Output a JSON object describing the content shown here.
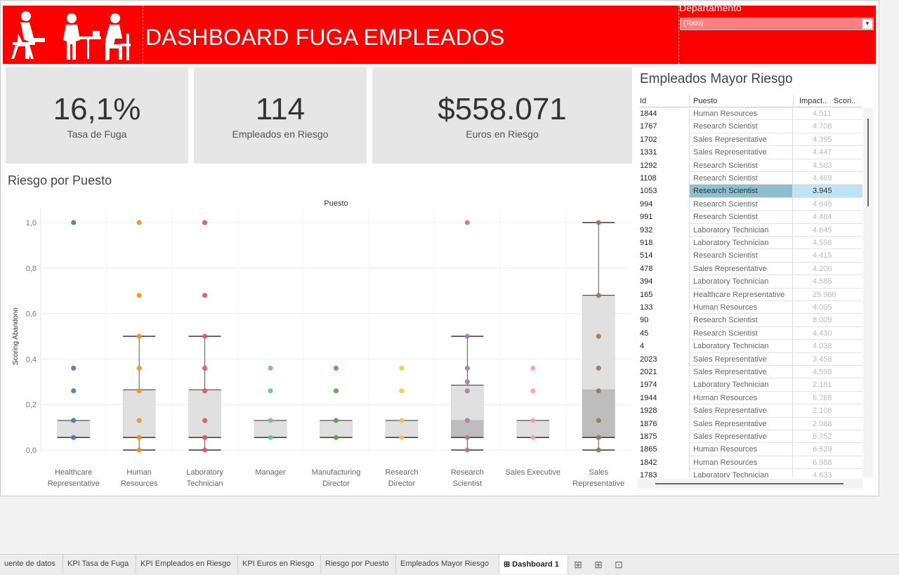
{
  "header": {
    "title": "DASHBOARD FUGA EMPLEADOS",
    "filter_label": "Departamento",
    "filter_value": "(Todo)"
  },
  "kpis": [
    {
      "value": "16,1%",
      "label": "Tasa de Fuga"
    },
    {
      "value": "114",
      "label": "Empleados en Riesgo"
    },
    {
      "value": "$558.071",
      "label": "Euros en Riesgo"
    }
  ],
  "chart_title": "Riesgo por Puesto",
  "chart_data": {
    "type": "scatter",
    "title": "Puesto",
    "xlabel": "",
    "ylabel": "Scoring Abandono",
    "ylim": [
      0,
      1.0
    ],
    "yticks": [
      "0,0",
      "0,2",
      "0,4",
      "0,6",
      "0,8",
      "1,0"
    ],
    "grid": true,
    "categories": [
      "Healthcare Representative",
      "Human Resources",
      "Laboratory Technician",
      "Manager",
      "Manufacturing Director",
      "Research Director",
      "Research Scientist",
      "Sales Executive",
      "Sales Representative"
    ],
    "colors": [
      "#4e79a7",
      "#f28e2b",
      "#e15759",
      "#76b7b2",
      "#59a14f",
      "#edc948",
      "#b07aa1",
      "#ff9da7",
      "#9c755f"
    ],
    "series": [
      {
        "values": [
          1.0,
          0.36,
          0.26,
          0.13,
          0.055
        ],
        "box": {
          "q1": 0.055,
          "median": 0.055,
          "q3": 0.13,
          "whisker_low": 0.055,
          "whisker_high": 0.13
        }
      },
      {
        "values": [
          1.0,
          0.68,
          0.5,
          0.36,
          0.26,
          0.13,
          0.055,
          0.0
        ],
        "box": {
          "q1": 0.055,
          "median": 0.055,
          "q3": 0.265,
          "whisker_low": 0.0,
          "whisker_high": 0.5
        }
      },
      {
        "values": [
          1.0,
          0.68,
          0.5,
          0.36,
          0.26,
          0.13,
          0.055,
          0.0
        ],
        "box": {
          "q1": 0.055,
          "median": 0.055,
          "q3": 0.265,
          "whisker_low": 0.0,
          "whisker_high": 0.5
        }
      },
      {
        "values": [
          0.36,
          0.26,
          0.13,
          0.055
        ],
        "box": {
          "q1": 0.055,
          "median": 0.055,
          "q3": 0.13,
          "whisker_low": 0.055,
          "whisker_high": 0.13
        }
      },
      {
        "values": [
          0.36,
          0.26,
          0.13,
          0.055
        ],
        "box": {
          "q1": 0.055,
          "median": 0.055,
          "q3": 0.13,
          "whisker_low": 0.055,
          "whisker_high": 0.13
        }
      },
      {
        "values": [
          0.36,
          0.26,
          0.13,
          0.055
        ],
        "box": {
          "q1": 0.055,
          "median": 0.055,
          "q3": 0.13,
          "whisker_low": 0.055,
          "whisker_high": 0.13
        }
      },
      {
        "values": [
          1.0,
          0.5,
          0.36,
          0.3,
          0.26,
          0.13,
          0.055,
          0.0
        ],
        "box": {
          "q1": 0.055,
          "median": 0.13,
          "q3": 0.285,
          "whisker_low": 0.0,
          "whisker_high": 0.5
        }
      },
      {
        "values": [
          0.36,
          0.26,
          0.13,
          0.055
        ],
        "box": {
          "q1": 0.055,
          "median": 0.055,
          "q3": 0.13,
          "whisker_low": 0.055,
          "whisker_high": 0.13
        }
      },
      {
        "values": [
          1.0,
          0.68,
          0.5,
          0.36,
          0.26,
          0.13,
          0.055,
          0.0
        ],
        "box": {
          "q1": 0.055,
          "median": 0.265,
          "q3": 0.68,
          "whisker_low": 0.0,
          "whisker_high": 1.0
        }
      }
    ]
  },
  "table": {
    "title": "Empleados Mayor Riesgo",
    "headers": [
      "Id",
      "Puesto",
      "Impact..",
      "Scori.."
    ],
    "rows": [
      {
        "id": "1844",
        "puesto": "Human Resources",
        "impacto": "4.511"
      },
      {
        "id": "1767",
        "puesto": "Research Scientist",
        "impacto": "4.708"
      },
      {
        "id": "1702",
        "puesto": "Sales Representative",
        "impacto": "4.395"
      },
      {
        "id": "1331",
        "puesto": "Sales Representative",
        "impacto": "4.447"
      },
      {
        "id": "1292",
        "puesto": "Research Scientist",
        "impacto": "4.583"
      },
      {
        "id": "1108",
        "puesto": "Research Scientist",
        "impacto": "4.469"
      },
      {
        "id": "1053",
        "puesto": "Research Scientist",
        "impacto": "3.945",
        "selected": true
      },
      {
        "id": "994",
        "puesto": "Research Scientist",
        "impacto": "4.645"
      },
      {
        "id": "991",
        "puesto": "Research Scientist",
        "impacto": "4.484"
      },
      {
        "id": "932",
        "puesto": "Laboratory Technician",
        "impacto": "4.645"
      },
      {
        "id": "918",
        "puesto": "Laboratory Technician",
        "impacto": "4.598"
      },
      {
        "id": "514",
        "puesto": "Research Scientist",
        "impacto": "4.415"
      },
      {
        "id": "478",
        "puesto": "Sales Representative",
        "impacto": "4.200"
      },
      {
        "id": "394",
        "puesto": "Laboratory Technician",
        "impacto": "4.585"
      },
      {
        "id": "165",
        "puesto": "Healthcare Representative",
        "impacto": "25.986"
      },
      {
        "id": "133",
        "puesto": "Human Resources",
        "impacto": "4.005"
      },
      {
        "id": "90",
        "puesto": "Research Scientist",
        "impacto": "8.009"
      },
      {
        "id": "45",
        "puesto": "Research Scientist",
        "impacto": "4.430"
      },
      {
        "id": "4",
        "puesto": "Laboratory Technician",
        "impacto": "4.038"
      },
      {
        "id": "2023",
        "puesto": "Sales Representative",
        "impacto": "3.458"
      },
      {
        "id": "2021",
        "puesto": "Sales Representative",
        "impacto": "4.598"
      },
      {
        "id": "1974",
        "puesto": "Laboratory Technician",
        "impacto": "2.181"
      },
      {
        "id": "1944",
        "puesto": "Human Resources",
        "impacto": "6.768"
      },
      {
        "id": "1928",
        "puesto": "Sales Representative",
        "impacto": "2.108"
      },
      {
        "id": "1876",
        "puesto": "Sales Representative",
        "impacto": "2.088"
      },
      {
        "id": "1875",
        "puesto": "Sales Representative",
        "impacto": "6.752"
      },
      {
        "id": "1865",
        "puesto": "Human Resources",
        "impacto": "6.629"
      },
      {
        "id": "1842",
        "puesto": "Human Resources",
        "impacto": "6.988"
      },
      {
        "id": "1783",
        "puesto": "Laboratory Technician",
        "impacto": "4.633"
      }
    ]
  },
  "tabs": [
    "uente de datos",
    "KPI Tasa de Fuga",
    "KPI Empleados en Riesgo",
    "KPI Euros en Riesgo",
    "Riesgo por Puesto",
    "Empleados Mayor Riesgo",
    "Dashboard 1"
  ],
  "active_tab": "Dashboard 1",
  "tab_icons": [
    "new-worksheet-icon",
    "new-dashboard-icon",
    "new-story-icon"
  ]
}
